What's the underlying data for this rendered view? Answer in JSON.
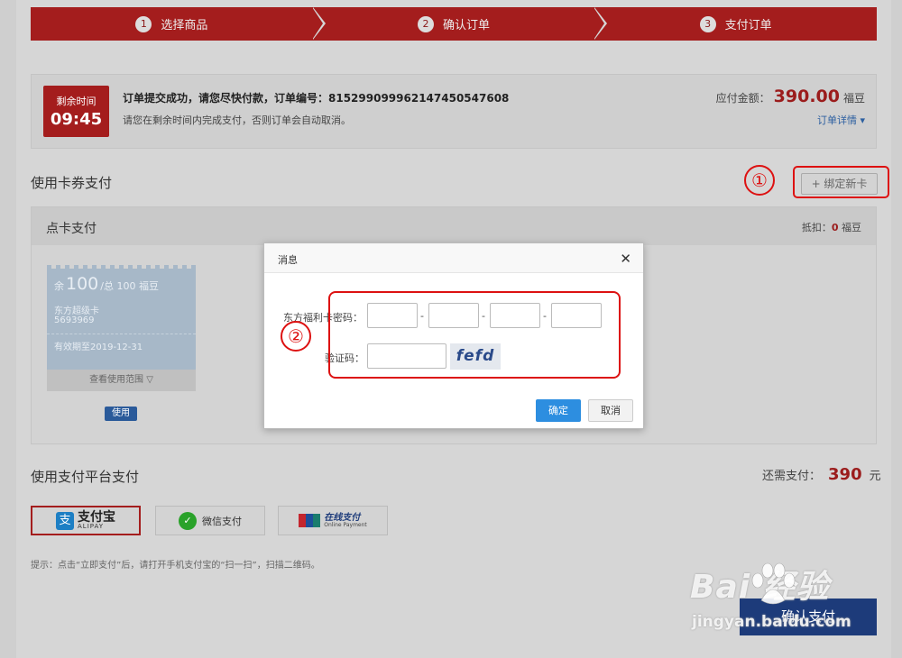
{
  "steps": [
    {
      "num": "1",
      "label": "选择商品"
    },
    {
      "num": "2",
      "label": "确认订单"
    },
    {
      "num": "3",
      "label": "支付订单"
    }
  ],
  "order": {
    "timer_label": "剩余时间",
    "timer_value": "09:45",
    "message": "订单提交成功，请您尽快付款，订单编号：8152990999621474505476​08",
    "sub_message": "请您在剩余时间内完成支付，否则订单会自动取消。",
    "amount_label": "应付金额：",
    "amount_value": "390.00",
    "amount_unit": "福豆",
    "detail_link": "订单详情 ▾"
  },
  "card_section": {
    "title": "使用卡券支付",
    "annotation_1": "①",
    "bind_button": "+ 绑定新卡",
    "panel_title": "点卡支付",
    "deduct_label": "抵扣：",
    "deduct_value": "0",
    "deduct_unit": "福豆",
    "coupon": {
      "balance_prefix": "余",
      "balance": "100",
      "total": "/总 100 福豆",
      "card_type": "东方超级卡",
      "card_number": "5693969",
      "valid_until": "有效期至2019-12-31",
      "scope_label": "查看使用范围 ▽"
    },
    "use_button": "使用"
  },
  "dialog": {
    "title": "消息",
    "close": "✕",
    "annotation_2": "②",
    "password_label": "东方福利卡密码：",
    "separator": "-",
    "captcha_label": "验证码：",
    "captcha_text": "fefd",
    "ok_button": "确定",
    "cancel_button": "取消"
  },
  "payment": {
    "title": "使用支付平台支付",
    "need_pay_label": "还需支付：",
    "need_pay_value": "390",
    "need_pay_unit": "元",
    "options": [
      {
        "main": "支付宝",
        "sub": "ALIPAY",
        "icon": "支"
      },
      {
        "main": "微信支付",
        "icon": "✓"
      },
      {
        "main": "在线支付",
        "sub": "Online Payment"
      }
    ],
    "hint": "提示：点击“立即支付”后，请打开手机支付宝的“扫一扫”，扫描二维码。",
    "confirm_button": "确认支付"
  },
  "watermark": {
    "brand": "Bai  经验",
    "url": "jingyan.baidu.com"
  }
}
